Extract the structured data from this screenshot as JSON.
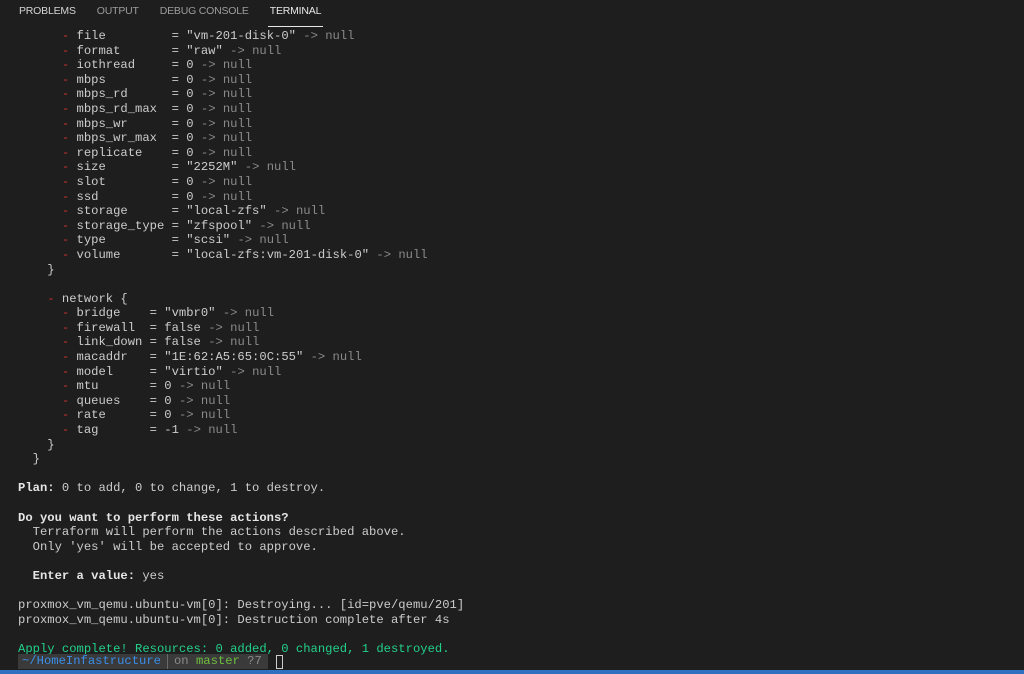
{
  "panel": {
    "tabs": [
      {
        "label": "PROBLEMS",
        "active": false
      },
      {
        "label": "OUTPUT",
        "active": false
      },
      {
        "label": "DEBUG CONSOLE",
        "active": false
      },
      {
        "label": "TERMINAL",
        "active": true
      }
    ]
  },
  "terminal": {
    "disk_attributes": [
      {
        "key": "file        ",
        "value": "\"vm-201-disk-0\""
      },
      {
        "key": "format      ",
        "value": "\"raw\""
      },
      {
        "key": "iothread    ",
        "value": "0"
      },
      {
        "key": "mbps        ",
        "value": "0"
      },
      {
        "key": "mbps_rd     ",
        "value": "0"
      },
      {
        "key": "mbps_rd_max ",
        "value": "0"
      },
      {
        "key": "mbps_wr     ",
        "value": "0"
      },
      {
        "key": "mbps_wr_max ",
        "value": "0"
      },
      {
        "key": "replicate   ",
        "value": "0"
      },
      {
        "key": "size        ",
        "value": "\"2252M\""
      },
      {
        "key": "slot        ",
        "value": "0"
      },
      {
        "key": "ssd         ",
        "value": "0"
      },
      {
        "key": "storage     ",
        "value": "\"local-zfs\""
      },
      {
        "key": "storage_type",
        "value": "\"zfspool\""
      },
      {
        "key": "type        ",
        "value": "\"scsi\""
      },
      {
        "key": "volume      ",
        "value": "\"local-zfs:vm-201-disk-0\""
      }
    ],
    "network_block": "network {",
    "network_attributes": [
      {
        "key": "bridge   ",
        "value": "\"vmbr0\""
      },
      {
        "key": "firewall ",
        "value": "false"
      },
      {
        "key": "link_down",
        "value": "false"
      },
      {
        "key": "macaddr  ",
        "value": "\"1E:62:A5:65:0C:55\""
      },
      {
        "key": "model    ",
        "value": "\"virtio\""
      },
      {
        "key": "mtu      ",
        "value": "0"
      },
      {
        "key": "queues   ",
        "value": "0"
      },
      {
        "key": "rate     ",
        "value": "0"
      },
      {
        "key": "tag      ",
        "value": "-1"
      }
    ],
    "arrow_null": "-> null",
    "plan_label": "Plan:",
    "plan_text": " 0 to add, 0 to change, 1 to destroy.",
    "question": "Do you want to perform these actions?",
    "question_line1": "  Terraform will perform the actions described above.",
    "question_line2": "  Only 'yes' will be accepted to approve.",
    "enter_label": "  Enter a value:",
    "enter_value": " yes",
    "destroying": "proxmox_vm_qemu.ubuntu-vm[0]: Destroying... [id=pve/qemu/201]",
    "destroyed": "proxmox_vm_qemu.ubuntu-vm[0]: Destruction complete after 4s",
    "apply_complete": "Apply complete! Resources: 0 added, 0 changed, 1 destroyed."
  },
  "prompt": {
    "path": "~/HomeInfastructure",
    "on": "on",
    "branch": "master",
    "status": "?7"
  },
  "colors": {
    "background": "#1e1e1e",
    "removed": "#cd3131",
    "success": "#23d18b",
    "statusbar": "#2f6fc0"
  }
}
